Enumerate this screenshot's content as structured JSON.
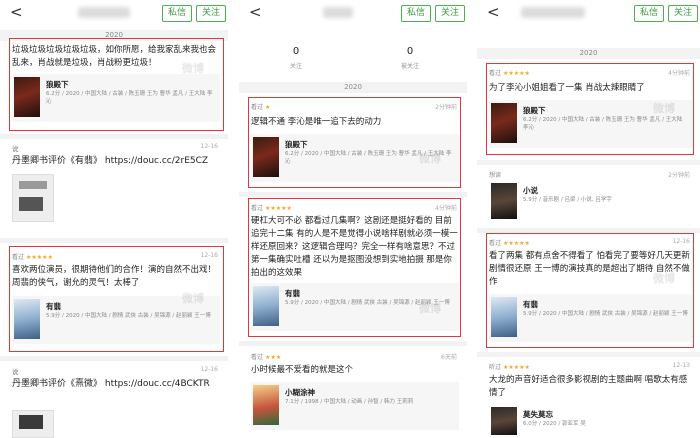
{
  "s1": {
    "back": "<",
    "msg_btn": "私信",
    "follow_btn": "关注",
    "year": "2020",
    "review1": "垃圾垃圾垃圾垃圾垃圾，如你所愿，给我家乱来我也会乱来，肖战就是垃圾，肖战粉更垃圾！",
    "movie1_title": "狼殿下",
    "movie1_info": "6.2分 / 2020 / 中国大陆 / 古装 / 陈玉珊 王为 曹华 孟凡 / 王大陆 李沁",
    "link1_user": "说",
    "link1_date": "12-16",
    "link1_text": "丹墨卿书评价《有翡》 https://douc.cc/2rE5CZ",
    "card2_user": "看过",
    "card2_stars": "★★★★★",
    "card2_date": "12-16",
    "review2": "喜欢两位演员，很期待他们的合作！演的自然不出戏！周翡的侠气，谢允的灵气！太棒了",
    "movie2_title": "有翡",
    "movie2_info": "5.9分 / 2020 / 中国大陆 / 剧情 武侠 古装 / 吴锦源 / 赵丽颖 王一博",
    "link2_user": "说",
    "link2_date": "12-16",
    "link2_text": "丹墨卿书评价《熹微》 https://douc.cc/4BCKTR"
  },
  "s2": {
    "back": "<",
    "msg_btn": "私信",
    "follow_btn": "关注",
    "follow_count": "0",
    "follow_label": "关注",
    "fans_count": "0",
    "fans_label": "被关注",
    "year": "2020",
    "card1_user": "看过",
    "card1_stars": "★",
    "card1_date": "2分钟前",
    "review1": "逻辑不通 李沁是唯一追下去的动力",
    "movie1_title": "狼殿下",
    "movie1_info": "6.2分 / 2020 / 中国大陆 / 古装 / 陈玉珊 王为 曹华 孟凡 / 王大陆 李沁",
    "card2_user": "看过",
    "card2_stars": "★★★★★",
    "card2_date": "4分钟前",
    "review2": "硬杠大可不必 都看过几集啊？这剧还是挺好看的 目前追完十二集 有的人是不是觉得小说啥样剧就必须一模一样还原回来？这逻辑合理吗？完全一样有啥意思？不过第一集确实吐槽 还以为是抠图没想到实地拍摄 那是你拍出的这效果",
    "movie2_title": "有翡",
    "movie2_info": "5.9分 / 2020 / 中国大陆 / 剧情 武侠 古装 / 吴锦源 / 赵丽颖 王一博",
    "card3_user": "看过",
    "card3_stars": "★★★",
    "card3_date": "6天前",
    "review3": "小时候最不爱看的就是这个",
    "movie3_title": "小糊涂神",
    "movie3_info": "7.1分 / 1998 / 中国大陆 / 动画 / 孙智 / 韩力 王莉莉"
  },
  "s3": {
    "back": "<",
    "msg_btn": "私信",
    "follow_btn": "关注",
    "year": "2020",
    "card1_user": "看过",
    "card1_stars": "★★★★★",
    "card1_date": "4分钟前",
    "review1": "为了李沁小姐姐看了一集 肖战太辣眼睛了",
    "movie1_title": "狼殿下",
    "movie1_info": "6.2分 / 2020 / 中国大陆 / 古装 / 陈玉珊 王为 曹华 孟凡 / 王大陆 李沁",
    "card2_user": "想读",
    "card2_date": "2分钟前",
    "book_title": "小说",
    "book_info": "5.9分 / 音乐剧 / 吕梁 / 小说, 吕学宇",
    "card3_user": "看过",
    "card3_stars": "★★★★★",
    "card3_date": "12-16",
    "review3": "看了两集 都有点舍不得看了 怕看完了要等好几天更新 剧情很还原 王一博的演技真的是超出了期待 自然不做作",
    "movie3_title": "有翡",
    "movie3_info": "5.9分 / 2020 / 中国大陆 / 剧情 武侠 古装 / 吴锦源 / 赵丽颖 王一博",
    "card4_user": "听过",
    "card4_stars": "★★★★★",
    "card4_date": "12-13",
    "review4": "大龙的声音好适合很多影视剧的主题曲啊 唱歌太有感情了",
    "movie4_title": "莫失莫忘",
    "movie4_info": "6.0分 / 2020 / 郭亚军 吴"
  },
  "watermark": "微博"
}
